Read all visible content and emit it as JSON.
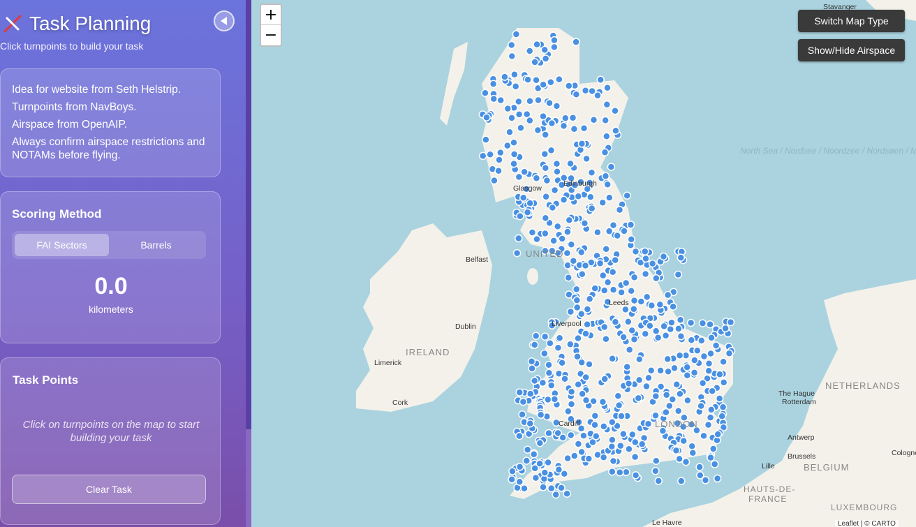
{
  "sidebar": {
    "title": "Task Planning",
    "subtitle": "Click turnpoints to build your task",
    "info": [
      "Idea for website from Seth Helstrip.",
      "Turnpoints from NavBoys.",
      "Airspace from OpenAIP.",
      "Always confirm airspace restrictions and NOTAMs before flying."
    ],
    "scoring": {
      "title": "Scoring Method",
      "options": [
        "FAI Sectors",
        "Barrels"
      ],
      "selected": "FAI Sectors",
      "distance": "0.0",
      "unit": "kilometers"
    },
    "task": {
      "title": "Task Points",
      "hint": "Click on turnpoints on the map to start building your task",
      "clear_label": "Clear Task"
    }
  },
  "map": {
    "zoom_in": "+",
    "zoom_out": "−",
    "switch_label": "Switch Map Type",
    "airspace_label": "Show/Hide Airspace",
    "labels": {
      "stavanger": "Stavanger",
      "north_sea": "North Sea / Nordsee / Noordzee / Nordsøen / Mer du Nord",
      "glasgow": "Glasgow",
      "edinburgh": "Edinburgh",
      "belfast": "Belfast",
      "united": "UNITED",
      "leeds": "Leeds",
      "liverpool": "Liverpool",
      "dublin": "Dublin",
      "ireland": "IRELAND",
      "limerick": "Limerick",
      "cork": "Cork",
      "cardiff": "Cardiff",
      "london": "LONDON",
      "the_hague": "The Hague",
      "rotterdam": "Rotterdam",
      "netherlands": "NETHERLANDS",
      "antwerp": "Antwerp",
      "brussels": "Brussels",
      "belgium": "BELGIUM",
      "lille": "Lille",
      "cologne": "Cologne",
      "hauts": "HAUTS-DE-",
      "france": "FRANCE",
      "luxembourg": "LUXEMBOURG",
      "le_havre": "Le Havre"
    },
    "attribution": "Leaflet | © CARTO",
    "colors": {
      "water": "#aad3df",
      "land": "#f4f1ea",
      "marker": "#4a90e2"
    }
  }
}
